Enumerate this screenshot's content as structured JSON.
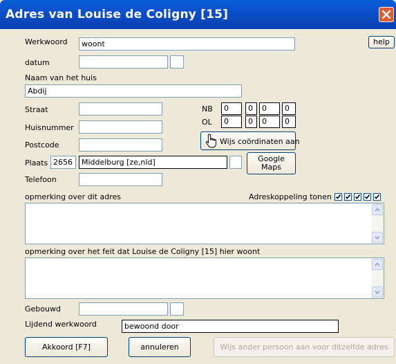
{
  "window": {
    "title": "Adres van Louise de Coligny [15]"
  },
  "help_label": "help",
  "werkwoord": {
    "label": "Werkwoord",
    "value": "woont"
  },
  "datum": {
    "label": "datum",
    "value": "",
    "suffix": ""
  },
  "huis": {
    "label": "Naam van het huis",
    "value": "Abdij"
  },
  "straat": {
    "label": "Straat",
    "value": ""
  },
  "huisnummer": {
    "label": "Huisnummer",
    "value": ""
  },
  "postcode": {
    "label": "Postcode",
    "value": ""
  },
  "plaats": {
    "label": "Plaats",
    "code": "2656",
    "value": "Middelburg [ze,nld]",
    "suffix": ""
  },
  "telefoon": {
    "label": "Telefoon",
    "value": ""
  },
  "coords": {
    "nb_label": "NB",
    "ol_label": "OL",
    "nb": [
      "0",
      "0",
      "0",
      "0"
    ],
    "ol": [
      "0",
      "0",
      "0",
      "0"
    ],
    "show_button": "Wijs coördinaten aan",
    "maps_button_line1": "Google",
    "maps_button_line2": "Maps"
  },
  "opmerking_adres": {
    "label": "opmerking over dit adres",
    "value": ""
  },
  "adreskoppeling": {
    "label": "Adreskoppeling tonen in",
    "checks": [
      true,
      true,
      true,
      true,
      true
    ]
  },
  "opmerking_feit": {
    "label": "opmerking over het feit dat Louise de Coligny [15] hier woont",
    "value": ""
  },
  "gebouwd": {
    "label": "Gebouwd",
    "value": "",
    "suffix": ""
  },
  "lijdend": {
    "label": "Lijdend werkwoord",
    "value": "bewoond door"
  },
  "footer": {
    "ok": "Akkoord [F7]",
    "cancel": "annuleren",
    "other": "Wijs ander persoon aan voor ditzelfde adres"
  },
  "colors": {
    "titlebar": "#0b4fc9",
    "dialog_bg": "#ece9d8",
    "close": "#e05a2c"
  },
  "icons": {
    "close": "close-icon",
    "hand": "pointer-hand-icon",
    "scroll_up": "scroll-up-icon",
    "scroll_down": "scroll-down-icon"
  }
}
